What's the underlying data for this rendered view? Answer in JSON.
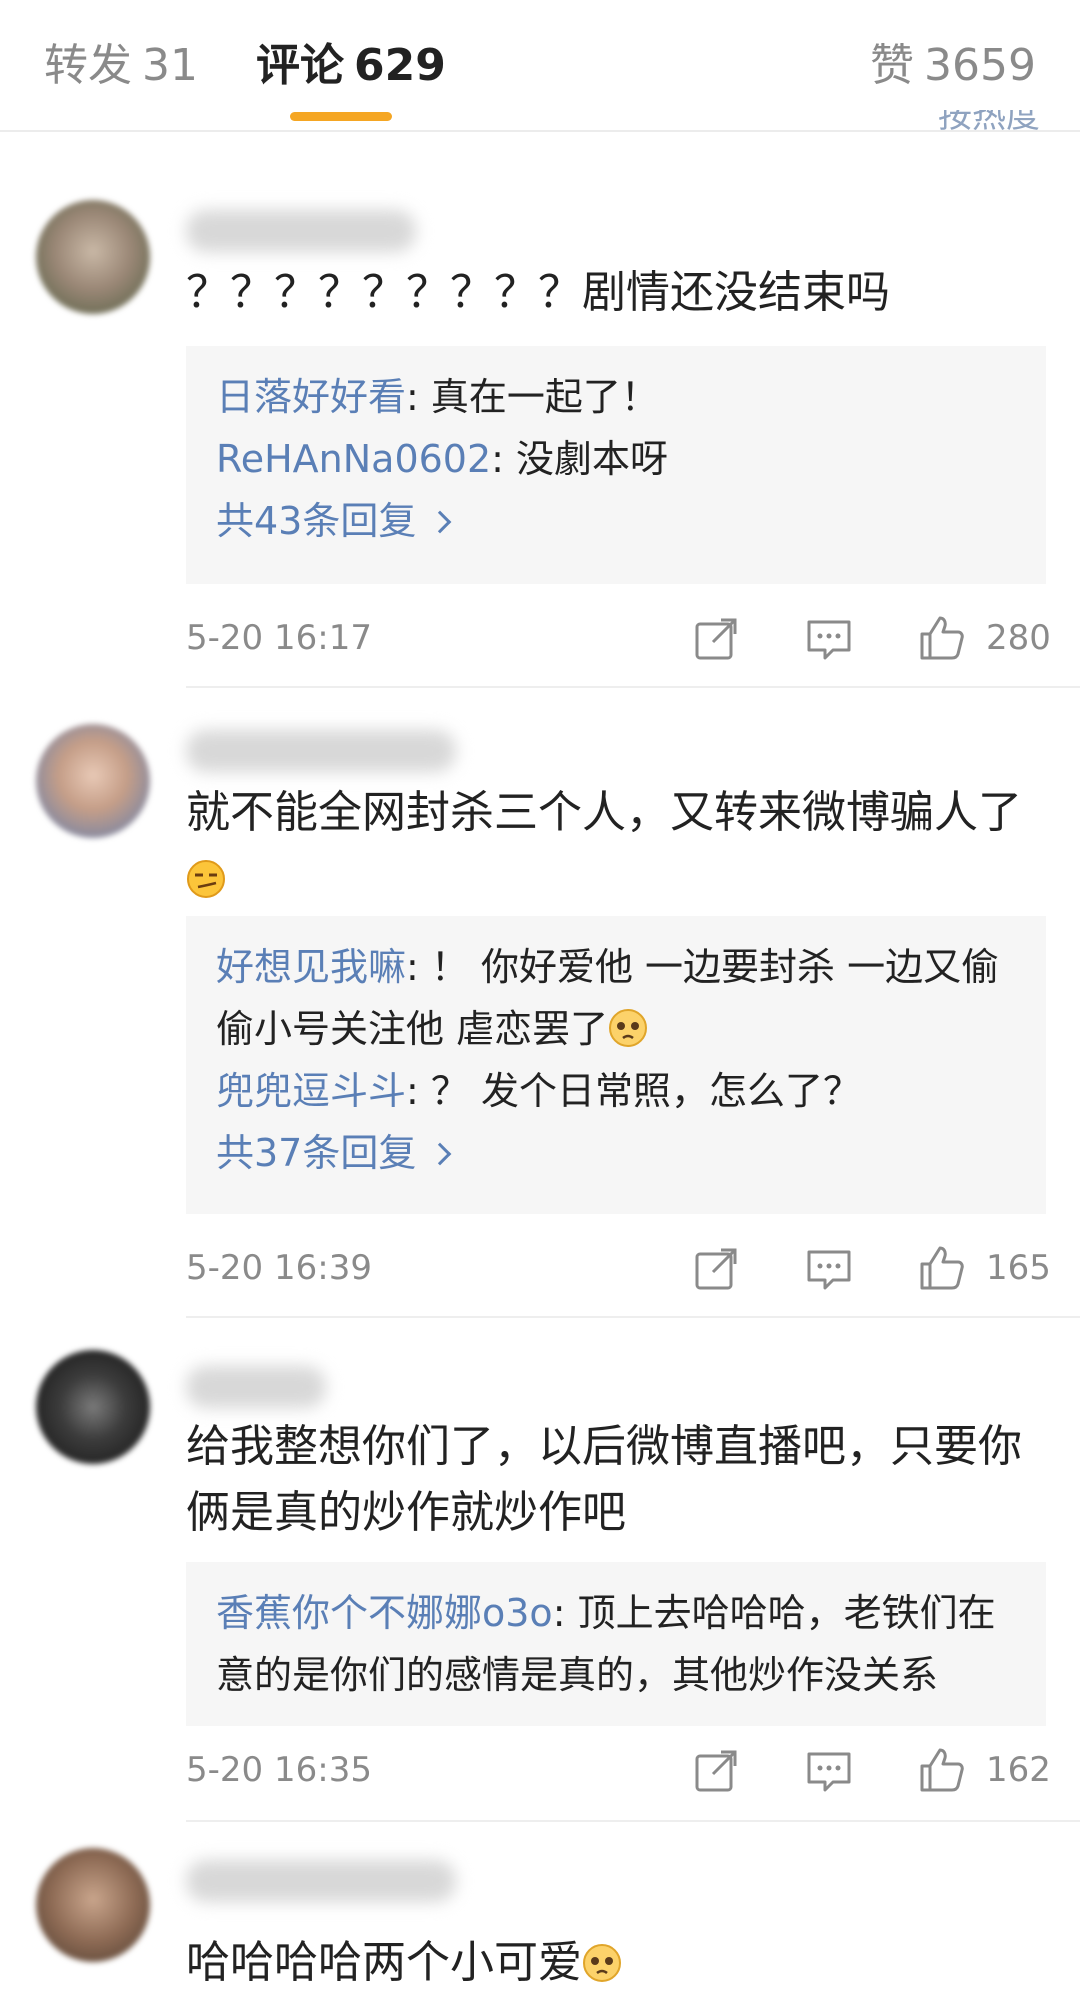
{
  "tabs": {
    "repost": {
      "label": "转发",
      "count": "31"
    },
    "comment": {
      "label": "评论",
      "count": "629"
    },
    "like": {
      "label": "赞",
      "count": "3659"
    }
  },
  "sort_label": "按热度",
  "icons": {
    "share": "share-icon",
    "comment": "comment-icon",
    "like": "thumbs-up-icon"
  },
  "colors": {
    "accent": "#f5a623",
    "link": "#5a7fb6",
    "reply_bg": "#f6f6f6"
  },
  "comments": [
    {
      "text": "？？？？？？？？？剧情还没结束吗",
      "replies": [
        {
          "user": "日落好好看",
          "text": ": 真在一起了！"
        },
        {
          "user": "ReHAnNa0602",
          "text": ": 没劇本呀"
        }
      ],
      "more": "共43条回复",
      "time": "5-20 16:17",
      "likes": "280"
    },
    {
      "text": "就不能全网封杀三个人，又转来微博骗人了",
      "replies": [
        {
          "user": "好想见我嘛",
          "text": ": ！ 你好爱他 一边要封杀 一边又偷偷小号关注他 虐恋罢了"
        },
        {
          "user": "兜兜逗斗斗",
          "text": ": ？ 发个日常照，怎么了？"
        }
      ],
      "more": "共37条回复",
      "time": "5-20 16:39",
      "likes": "165"
    },
    {
      "text": "给我整想你们了，以后微博直播吧，只要你俩是真的炒作就炒作吧",
      "replies": [
        {
          "user": "香蕉你个不娜娜o3o",
          "text": ": 顶上去哈哈哈，老铁们在意的是你们的感情是真的，其他炒作没关系"
        }
      ],
      "time": "5-20 16:35",
      "likes": "162"
    },
    {
      "text": "哈哈哈哈两个小可爱"
    }
  ]
}
